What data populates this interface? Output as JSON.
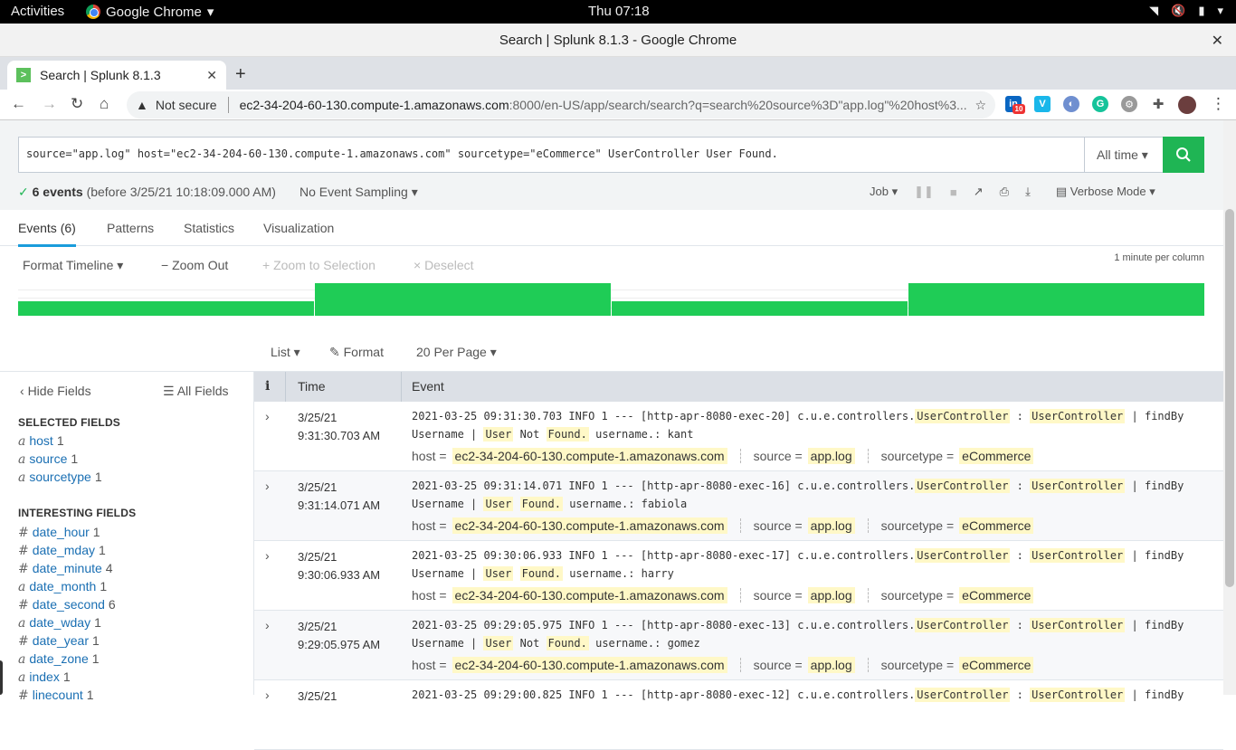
{
  "os": {
    "activities": "Activities",
    "app_name": "Google Chrome",
    "clock": "Thu 07:18"
  },
  "window": {
    "title": "Search | Splunk 8.1.3 - Google Chrome"
  },
  "browser": {
    "tab_title": "Search | Splunk 8.1.3",
    "not_secure": "Not secure",
    "url_host": "ec2-34-204-60-130.compute-1.amazonaws.com",
    "url_rest": ":8000/en-US/app/search/search?q=search%20source%3D\"app.log\"%20host%3...",
    "ext_badge": "10"
  },
  "search": {
    "query": "source=\"app.log\" host=\"ec2-34-204-60-130.compute-1.amazonaws.com\" sourcetype=\"eCommerce\" UserController User Found.",
    "time_range": "All time ▾"
  },
  "status": {
    "count": "6 events",
    "detail": "(before 3/25/21 10:18:09.000 AM)",
    "sampling": "No Event Sampling ▾",
    "job": "Job ▾",
    "mode": "Verbose Mode ▾"
  },
  "tabs": {
    "events": "Events (6)",
    "patterns": "Patterns",
    "statistics": "Statistics",
    "visualization": "Visualization"
  },
  "timeline": {
    "format": "Format Timeline ▾",
    "zoom_out": "− Zoom Out",
    "zoom_sel": "+ Zoom to Selection",
    "deselect": "× Deselect",
    "scale": "1 minute per column",
    "bars": [
      0.45,
      1.0,
      0.45,
      1.0
    ]
  },
  "list": {
    "view": "List ▾",
    "format": "Format",
    "per_page": "20 Per Page ▾"
  },
  "fields": {
    "hide": "Hide Fields",
    "all": "All Fields",
    "selected_title": "SELECTED FIELDS",
    "interesting_title": "INTERESTING FIELDS",
    "selected": [
      {
        "type": "a",
        "name": "host",
        "count": "1"
      },
      {
        "type": "a",
        "name": "source",
        "count": "1"
      },
      {
        "type": "a",
        "name": "sourcetype",
        "count": "1"
      }
    ],
    "interesting": [
      {
        "type": "#",
        "name": "date_hour",
        "count": "1"
      },
      {
        "type": "#",
        "name": "date_mday",
        "count": "1"
      },
      {
        "type": "#",
        "name": "date_minute",
        "count": "4"
      },
      {
        "type": "a",
        "name": "date_month",
        "count": "1"
      },
      {
        "type": "#",
        "name": "date_second",
        "count": "6"
      },
      {
        "type": "a",
        "name": "date_wday",
        "count": "1"
      },
      {
        "type": "#",
        "name": "date_year",
        "count": "1"
      },
      {
        "type": "a",
        "name": "date_zone",
        "count": "1"
      },
      {
        "type": "a",
        "name": "index",
        "count": "1"
      },
      {
        "type": "#",
        "name": "linecount",
        "count": "1"
      }
    ]
  },
  "table": {
    "col_info": "i",
    "col_time": "Time",
    "col_event": "Event",
    "meta_host_label": "host =",
    "meta_source_label": "source =",
    "meta_st_label": "sourcetype =",
    "host": "ec2-34-204-60-130.compute-1.amazonaws.com",
    "source": "app.log",
    "sourcetype": "eCommerce",
    "rows": [
      {
        "date": "3/25/21",
        "time": "9:31:30.703 AM",
        "prefix": "2021-03-25 09:31:30.703  INFO 1 --- [http-apr-8080-exec-20] c.u.e.controllers.",
        "notfound": true,
        "user": "kant"
      },
      {
        "date": "3/25/21",
        "time": "9:31:14.071 AM",
        "prefix": "2021-03-25 09:31:14.071  INFO 1 --- [http-apr-8080-exec-16] c.u.e.controllers.",
        "notfound": false,
        "user": "fabiola"
      },
      {
        "date": "3/25/21",
        "time": "9:30:06.933 AM",
        "prefix": "2021-03-25 09:30:06.933  INFO 1 --- [http-apr-8080-exec-17] c.u.e.controllers.",
        "notfound": false,
        "user": "harry"
      },
      {
        "date": "3/25/21",
        "time": "9:29:05.975 AM",
        "prefix": "2021-03-25 09:29:05.975  INFO 1 --- [http-apr-8080-exec-13] c.u.e.controllers.",
        "notfound": true,
        "user": "gomez"
      },
      {
        "date": "3/25/21",
        "time": "",
        "prefix": "2021-03-25 09:29:00.825  INFO 1 --- [http-apr-8080-exec-12] c.u.e.controllers.",
        "notfound": false,
        "user": ""
      }
    ],
    "controller": "UserController",
    "colon": " : ",
    "findby": " | findBy",
    "username": "Username | ",
    "user_word": "User",
    "not_word": " Not ",
    "found_word": "Found.",
    "uname_label": " username.: "
  }
}
